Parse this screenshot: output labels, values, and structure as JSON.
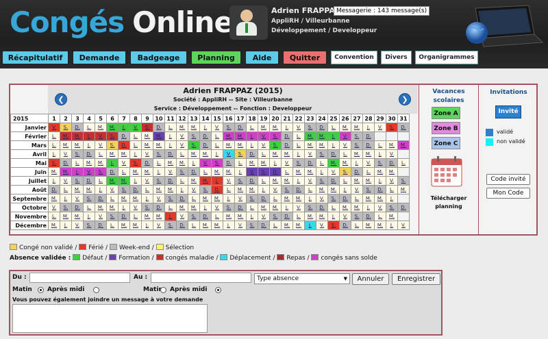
{
  "app": {
    "logo_part1": "Congés",
    "logo_part2": "Online"
  },
  "user": {
    "name": "Adrien FRAPPAZ",
    "messagerie": "Messagerie : 143 message(s)",
    "company": "AppliRH / Villeurbanne",
    "service": "Développement / Developpeur"
  },
  "nav": {
    "recap": "Récapitulatif",
    "demande": "Demande",
    "badgeage": "Badgeage",
    "planning": "Planning",
    "aide": "Aide",
    "quitter": "Quitter",
    "convention": "Convention",
    "divers": "Divers",
    "organigrammes": "Organigrammes"
  },
  "calendar": {
    "title": "Adrien FRAPPAZ (2015)",
    "societe": "Société : AppliRH -- Site : Villeurbanne",
    "service": "Service : Développement -- Fonction : Developpeur",
    "prev": "❮",
    "next": "❯",
    "year": "2015",
    "days": [
      "1",
      "2",
      "3",
      "4",
      "5",
      "6",
      "7",
      "8",
      "9",
      "10",
      "11",
      "12",
      "13",
      "14",
      "15",
      "16",
      "17",
      "18",
      "19",
      "20",
      "21",
      "22",
      "23",
      "24",
      "25",
      "26",
      "27",
      "28",
      "29",
      "30",
      "31"
    ],
    "months": [
      {
        "name": "Janvier",
        "first": 4,
        "len": 31,
        "codes": {
          "1": "ferie",
          "2": "conge",
          "6": "defaut",
          "7": "defaut",
          "8": "defaut",
          "9": "maladie",
          "30": "ferie"
        }
      },
      {
        "name": "Février",
        "first": 0,
        "len": 28,
        "codes": {
          "2": "maladie",
          "3": "maladie",
          "4": "maladie",
          "5": "maladie",
          "6": "maladie",
          "10": "form",
          "16": "sans",
          "17": "sans",
          "18": "sans",
          "19": "sans",
          "20": "sans",
          "23": "defaut",
          "24": "defaut",
          "25": "defaut",
          "26": "sans"
        }
      },
      {
        "name": "Mars",
        "first": 0,
        "len": 31,
        "codes": {
          "6": "conge",
          "7": "ferie",
          "13": "defaut",
          "20": "defaut",
          "31": "sans"
        }
      },
      {
        "name": "Avril",
        "first": 3,
        "len": 30,
        "codes": {
          "16": "depl",
          "17": "conge"
        }
      },
      {
        "name": "Mai",
        "first": 5,
        "len": 31,
        "codes": {
          "1": "ferie",
          "6": "defaut",
          "8": "ferie",
          "14": "sans",
          "15": "sans",
          "25": "defaut"
        }
      },
      {
        "name": "Juin",
        "first": 1,
        "len": 30,
        "codes": {
          "2": "sans",
          "3": "sans",
          "4": "sans",
          "5": "sans",
          "18": "form",
          "19": "form",
          "20": "form",
          "26": "conge"
        }
      },
      {
        "name": "Juillet",
        "first": 3,
        "len": 31,
        "codes": {
          "6": "defaut",
          "7": "defaut",
          "14": "ferie",
          "15": "ferie"
        }
      },
      {
        "name": "Août",
        "first": 6,
        "len": 31,
        "codes": {
          "15": "ferie"
        }
      },
      {
        "name": "Septembre",
        "first": 2,
        "len": 30,
        "codes": {}
      },
      {
        "name": "Octobre",
        "first": 4,
        "len": 31,
        "codes": {}
      },
      {
        "name": "Novembre",
        "first": 0,
        "len": 30,
        "codes": {
          "11": "ferie"
        }
      },
      {
        "name": "Décembre",
        "first": 2,
        "len": 31,
        "codes": {
          "25": "ferie",
          "23": "depl"
        }
      }
    ],
    "cell_labels": {
      "0": "L.",
      "1": "M.",
      "2": "M.",
      "3": "J.",
      "4": "V.",
      "5": "S.",
      "6": "D."
    }
  },
  "vacances": {
    "title": "Vacances scolaires",
    "zone_a": "Zone A",
    "zone_b": "Zone B",
    "zone_c": "Zone C",
    "colors": {
      "a": "#5cd65c",
      "b": "#e08ae0",
      "c": "#a9c5ec"
    },
    "download": "Télécharger planning"
  },
  "invitations": {
    "title": "Invitations",
    "invite_btn": "Invité",
    "valide": "validé",
    "non_valide": "non validé",
    "code_invite": "Code invité",
    "mon_code": "Mon Code"
  },
  "legend": {
    "conge_non_valide": "Congé non validé /",
    "ferie": "Férié /",
    "weekend": "Week-end /",
    "selection": "Sélection",
    "absence_validee": "Absence validée :",
    "defaut": "Défaut /",
    "formation": "Formation /",
    "maladie": "congés maladie /",
    "deplacement": "Déplacement /",
    "repas": "Repas /",
    "sans_solde": "congés sans solde"
  },
  "form": {
    "du": "Du :",
    "au": "Au :",
    "matin": "Matin",
    "apres_midi": "Après midi",
    "type_absence": "Type absence",
    "annuler": "Annuler",
    "enregistrer": "Enregistrer",
    "message_label": "Vous pouvez également joindre un message à votre demande"
  }
}
